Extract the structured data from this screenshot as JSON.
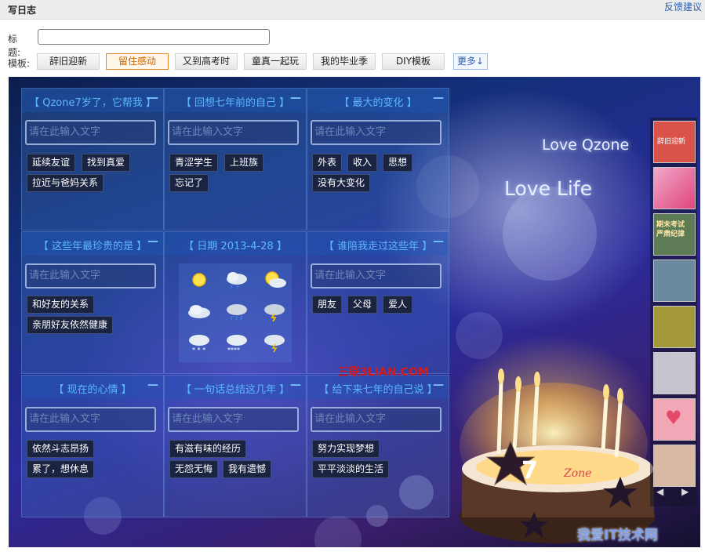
{
  "header": {
    "title": "写日志",
    "feedback": "反馈建议"
  },
  "form": {
    "title_label": "标题:",
    "title_value": "",
    "template_label": "模板:",
    "templates": [
      "辞旧迎新",
      "留住感动",
      "又到高考时",
      "童真一起玩",
      "我的毕业季",
      "DIY模板"
    ],
    "selected_template": "留住感动",
    "more_label": "更多↓"
  },
  "template_canvas": {
    "input_placeholder": "请在此输入文字",
    "collapse_symbol": "—",
    "cells": [
      {
        "title": "【 Qzone7岁了，它帮我 】",
        "tags": [
          "延续友谊",
          "找到真爱",
          "拉近与爸妈关系"
        ]
      },
      {
        "title": "【 回想七年前的自己 】",
        "tags": [
          "青涩学生",
          "上班族",
          "忘记了"
        ]
      },
      {
        "title": "【 最大的变化 】",
        "tags": [
          "外表",
          "收入",
          "思想",
          "没有大变化"
        ]
      },
      {
        "title": "【 这些年最珍贵的是 】",
        "tags": [
          "和好友的关系",
          "亲朋好友依然健康"
        ]
      },
      {
        "title": "【 日期 2013-4-28 】",
        "weather_icons": [
          "sun-icon",
          "cloud-rain-icon",
          "sun-cloud-icon",
          "cloud-icon",
          "cloud-drizzle-icon",
          "cloud-thunder-icon",
          "snow-icon",
          "snow-heavy-icon",
          "snow-thunder-icon"
        ]
      },
      {
        "title": "【 谁陪我走过这些年 】",
        "tags": [
          "朋友",
          "父母",
          "爱人"
        ]
      },
      {
        "title": "【 现在的心情 】",
        "tags": [
          "依然斗志昂扬",
          "累了，想休息"
        ]
      },
      {
        "title": "【 一句话总结这几年 】",
        "tags": [
          "有滋有味的经历",
          "无怨无悔",
          "我有遗憾"
        ]
      },
      {
        "title": "【 给下来七年的自己说 】",
        "tags": [
          "努力实现梦想",
          "平平淡淡的生活"
        ]
      }
    ],
    "background_texts": [
      "Love Qzone",
      "Love Life"
    ],
    "cake_number": "7",
    "cake_script": "Zone"
  },
  "thumbnails": {
    "items": [
      {
        "name": "thumb-new-year",
        "color": "#d9534a",
        "text": "辞旧迎新"
      },
      {
        "name": "thumb-lovers",
        "color": "#e0447e",
        "text": ""
      },
      {
        "name": "thumb-exam",
        "color": "#5d7b54",
        "text": "期末考试 严肃纪律"
      },
      {
        "name": "thumb-graduate",
        "color": "#6b8aa0",
        "text": ""
      },
      {
        "name": "thumb-autumn",
        "color": "#a49a3c",
        "text": ""
      },
      {
        "name": "thumb-girl",
        "color": "#c7c3cf",
        "text": ""
      },
      {
        "name": "thumb-heart",
        "color": "#f1a7b6",
        "text": ""
      },
      {
        "name": "thumb-room",
        "color": "#d9b9a4",
        "text": ""
      }
    ],
    "prev_arrow": "◀",
    "next_arrow": "▶"
  },
  "watermarks": {
    "site1": "三联3LIAN.COM",
    "site2": "我爱IT技术网"
  }
}
